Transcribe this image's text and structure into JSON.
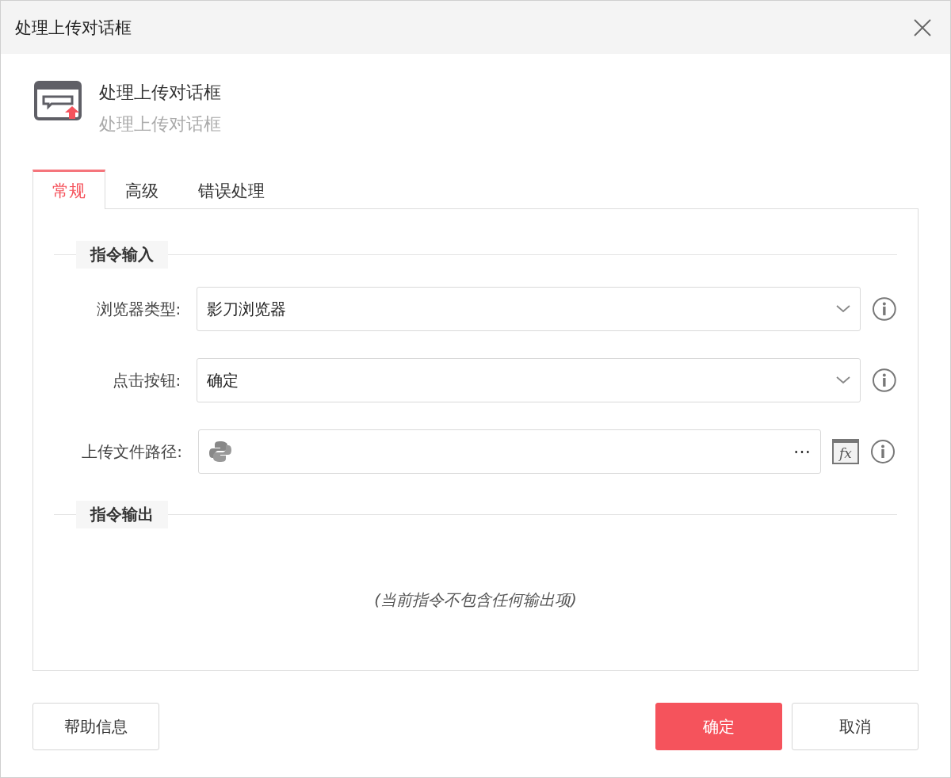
{
  "window": {
    "title": "处理上传对话框"
  },
  "header": {
    "title": "处理上传对话框",
    "subtitle": "处理上传对话框"
  },
  "tabs": [
    {
      "label": "常规",
      "selected": true
    },
    {
      "label": "高级",
      "selected": false
    },
    {
      "label": "错误处理",
      "selected": false
    }
  ],
  "sections": [
    {
      "title": "指令输入",
      "fields": [
        {
          "kind": "select",
          "label": "浏览器类型:",
          "value": "影刀浏览器"
        },
        {
          "kind": "select",
          "label": "点击按钮:",
          "value": "确定"
        },
        {
          "kind": "path",
          "label": "上传文件路径:",
          "more": "⋯",
          "fx": "fx"
        }
      ]
    },
    {
      "title": "指令输出",
      "note": "(当前指令不包含任何输出项)"
    }
  ],
  "buttons": [
    {
      "label": "帮助信息",
      "kind": "help"
    },
    {
      "label": "确定",
      "kind": "primary"
    },
    {
      "label": "取消",
      "kind": "secondary"
    }
  ]
}
